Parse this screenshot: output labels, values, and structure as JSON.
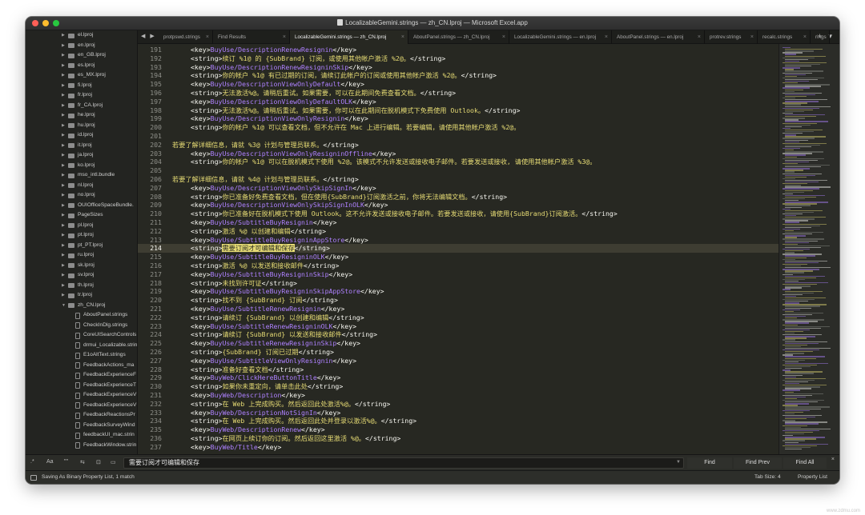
{
  "window": {
    "title": "LocalizableGemini.strings — zh_CN.lproj — Microsoft Excel.app"
  },
  "sidebar": {
    "items": [
      {
        "label": "el.lproj",
        "kind": "folder",
        "level": 1
      },
      {
        "label": "en.lproj",
        "kind": "folder",
        "level": 1
      },
      {
        "label": "en_GB.lproj",
        "kind": "folder",
        "level": 1
      },
      {
        "label": "es.lproj",
        "kind": "folder",
        "level": 1
      },
      {
        "label": "es_MX.lproj",
        "kind": "folder",
        "level": 1
      },
      {
        "label": "fi.lproj",
        "kind": "folder",
        "level": 1
      },
      {
        "label": "fr.lproj",
        "kind": "folder",
        "level": 1
      },
      {
        "label": "fr_CA.lproj",
        "kind": "folder",
        "level": 1
      },
      {
        "label": "he.lproj",
        "kind": "folder",
        "level": 1
      },
      {
        "label": "hu.lproj",
        "kind": "folder",
        "level": 1
      },
      {
        "label": "id.lproj",
        "kind": "folder",
        "level": 1
      },
      {
        "label": "it.lproj",
        "kind": "folder",
        "level": 1
      },
      {
        "label": "ja.lproj",
        "kind": "folder",
        "level": 1
      },
      {
        "label": "ko.lproj",
        "kind": "folder",
        "level": 1
      },
      {
        "label": "mso_intl.bundle",
        "kind": "folder",
        "level": 1
      },
      {
        "label": "nl.lproj",
        "kind": "folder",
        "level": 1
      },
      {
        "label": "no.lproj",
        "kind": "folder",
        "level": 1
      },
      {
        "label": "OUIOfficeSpaceBundle.",
        "kind": "folder",
        "level": 1
      },
      {
        "label": "PageSizes",
        "kind": "folder",
        "level": 1
      },
      {
        "label": "pl.lproj",
        "kind": "folder",
        "level": 1
      },
      {
        "label": "pt.lproj",
        "kind": "folder",
        "level": 1
      },
      {
        "label": "pt_PT.lproj",
        "kind": "folder",
        "level": 1
      },
      {
        "label": "ru.lproj",
        "kind": "folder",
        "level": 1
      },
      {
        "label": "sk.lproj",
        "kind": "folder",
        "level": 1
      },
      {
        "label": "sv.lproj",
        "kind": "folder",
        "level": 1
      },
      {
        "label": "th.lproj",
        "kind": "folder",
        "level": 1
      },
      {
        "label": "tr.lproj",
        "kind": "folder",
        "level": 1
      },
      {
        "label": "zh_CN.lproj",
        "kind": "folder-open",
        "level": 1
      },
      {
        "label": "AboutPanel.strings",
        "kind": "file",
        "level": 2
      },
      {
        "label": "CheckInDlg.strings",
        "kind": "file",
        "level": 2
      },
      {
        "label": "CoreUISearchControls",
        "kind": "file",
        "level": 2
      },
      {
        "label": "drmui_Localizable.strin",
        "kind": "file",
        "level": 2
      },
      {
        "label": "E1oAltText.strings",
        "kind": "file",
        "level": 2
      },
      {
        "label": "FeedbackActions_ma",
        "kind": "file",
        "level": 2
      },
      {
        "label": "FeedbackExperienceF",
        "kind": "file",
        "level": 2
      },
      {
        "label": "FeedbackExperienceT",
        "kind": "file",
        "level": 2
      },
      {
        "label": "FeedbackExperienceV",
        "kind": "file",
        "level": 2
      },
      {
        "label": "FeedbackExperienceV",
        "kind": "file",
        "level": 2
      },
      {
        "label": "FeedbackReactionsPr",
        "kind": "file",
        "level": 2
      },
      {
        "label": "FeedbackSurveyWind",
        "kind": "file",
        "level": 2
      },
      {
        "label": "feedbackUI_mac.strin",
        "kind": "file",
        "level": 2
      },
      {
        "label": "FeedbackWindow.strin",
        "kind": "file",
        "level": 2
      }
    ]
  },
  "tabs": [
    {
      "label": "protpswd.strings",
      "active": false
    },
    {
      "label": "Find Results",
      "active": false
    },
    {
      "label": "LocalizableGemini.strings — zh_CN.lproj",
      "active": true
    },
    {
      "label": "AboutPanel.strings — zh_CN.lproj",
      "active": false
    },
    {
      "label": "LocalizableGemini.strings — en.lproj",
      "active": false
    },
    {
      "label": "AboutPanel.strings — en.lproj",
      "active": false
    },
    {
      "label": "protrev.strings",
      "active": false
    },
    {
      "label": "recalc.strings",
      "active": false
    },
    {
      "label": "rings",
      "active": false
    }
  ],
  "tab_nav": "◀ ▶",
  "tab_extra": "+ ▾",
  "editor": {
    "current_line": 214,
    "lines": [
      {
        "n": "191",
        "t": "key",
        "indent": true,
        "v": "BuyUse/DescriptionRenewResignin"
      },
      {
        "n": "192",
        "t": "string",
        "indent": true,
        "v": "续订 %1@ 的 {SubBrand} 订阅，或使用其他帐户激活 %2@。"
      },
      {
        "n": "193",
        "t": "key",
        "indent": true,
        "v": "BuyUse/DescriptionRenewResigninSkip"
      },
      {
        "n": "194",
        "t": "string",
        "indent": true,
        "v": "你的帐户 %1@ 有已过期的订阅，请续订此帐户的订阅或使用其他帐户激活 %2@。"
      },
      {
        "n": "195",
        "t": "key",
        "indent": true,
        "v": "BuyUse/DescriptionViewOnlyDefault"
      },
      {
        "n": "196",
        "t": "string",
        "indent": true,
        "v": "无法激活%@。请稍后重试。如果需要，可以在此期间免费查看文档。"
      },
      {
        "n": "197",
        "t": "key",
        "indent": true,
        "v": "BuyUse/DescriptionViewOnlyDefaultOLK"
      },
      {
        "n": "198",
        "t": "string",
        "indent": true,
        "v": "无法激活%@。请稍后重试。如果需要，你可以在此期间在脱机模式下免费使用 Outlook。"
      },
      {
        "n": "199",
        "t": "key",
        "indent": true,
        "v": "BuyUse/DescriptionViewOnlyResignin"
      },
      {
        "n": "200",
        "t": "string-open",
        "indent": true,
        "v": "你的帐户 %1@ 可以查看文档，但不允许在 Mac 上进行编辑。若要编辑，请使用其他帐户激活 %2@。"
      },
      {
        "n": "201",
        "t": "blank",
        "indent": false,
        "v": ""
      },
      {
        "n": "202",
        "t": "string-close",
        "indent": false,
        "v": "若要了解详细信息，请就 %3@ 计划与管理员联系。"
      },
      {
        "n": "203",
        "t": "key",
        "indent": true,
        "v": "BuyUse/DescriptionViewOnlyResigninOffline"
      },
      {
        "n": "204",
        "t": "string-open",
        "indent": true,
        "v": "你的帐户 %1@ 可以在脱机模式下使用 %2@。该模式不允许发送或接收电子邮件。若要发送或接收, 请使用其他帐户激活 %3@。"
      },
      {
        "n": "205",
        "t": "blank",
        "indent": false,
        "v": ""
      },
      {
        "n": "206",
        "t": "string-close",
        "indent": false,
        "v": "若要了解详细信息，请就 %4@ 计划与管理员联系。"
      },
      {
        "n": "207",
        "t": "key",
        "indent": true,
        "v": "BuyUse/DescriptionViewOnlySkipSignIn"
      },
      {
        "n": "208",
        "t": "string",
        "indent": true,
        "v": "你已准备好免费查看文档，但在使用{SubBrand}订阅激活之前，你将无法编辑文档。"
      },
      {
        "n": "209",
        "t": "key",
        "indent": true,
        "v": "BuyUse/DescriptionViewOnlySkipSignInOLK"
      },
      {
        "n": "210",
        "t": "string",
        "indent": true,
        "v": "你已准备好在脱机模式下使用 Outlook。这不允许发送或接收电子邮件。若要发送或接收，请使用{SubBrand}订阅激活。"
      },
      {
        "n": "211",
        "t": "key",
        "indent": true,
        "v": "BuyUse/SubtitleBuyResignin"
      },
      {
        "n": "212",
        "t": "string",
        "indent": true,
        "v": "激活 %@ 以创建和编辑"
      },
      {
        "n": "213",
        "t": "key",
        "indent": true,
        "v": "BuyUse/SubtitleBuyResigninAppStore"
      },
      {
        "n": "214",
        "t": "string-hl",
        "indent": true,
        "v": "需要订阅才可编辑和保存"
      },
      {
        "n": "215",
        "t": "key",
        "indent": true,
        "v": "BuyUse/SubtitleBuyResigninOLK"
      },
      {
        "n": "216",
        "t": "string",
        "indent": true,
        "v": "激活 %@ 以发送和接收邮件"
      },
      {
        "n": "217",
        "t": "key",
        "indent": true,
        "v": "BuyUse/SubtitleBuyResigninSkip"
      },
      {
        "n": "218",
        "t": "string",
        "indent": true,
        "v": "未找到许可证"
      },
      {
        "n": "219",
        "t": "key",
        "indent": true,
        "v": "BuyUse/SubtitleBuyResigninSkipAppStore"
      },
      {
        "n": "220",
        "t": "string",
        "indent": true,
        "v": "找不到 {SubBrand} 订阅"
      },
      {
        "n": "221",
        "t": "key",
        "indent": true,
        "v": "BuyUse/SubtitleRenewResignin"
      },
      {
        "n": "222",
        "t": "string",
        "indent": true,
        "v": "请续订 {SubBrand} 以创建和编辑"
      },
      {
        "n": "223",
        "t": "key",
        "indent": true,
        "v": "BuyUse/SubtitleRenewResigninOLK"
      },
      {
        "n": "224",
        "t": "string",
        "indent": true,
        "v": "请续订 {SubBrand} 以发送和接收邮件"
      },
      {
        "n": "225",
        "t": "key",
        "indent": true,
        "v": "BuyUse/SubtitleRenewResigninSkip"
      },
      {
        "n": "226",
        "t": "string",
        "indent": true,
        "v": "{SubBrand} 订阅已过期"
      },
      {
        "n": "227",
        "t": "key",
        "indent": true,
        "v": "BuyUse/SubtitleViewOnlyResignin"
      },
      {
        "n": "228",
        "t": "string",
        "indent": true,
        "v": "准备好查看文档"
      },
      {
        "n": "229",
        "t": "key",
        "indent": true,
        "v": "BuyWeb/ClickHereButtonTitle"
      },
      {
        "n": "230",
        "t": "string",
        "indent": true,
        "v": "如果你未重定向，请单击此处"
      },
      {
        "n": "231",
        "t": "key",
        "indent": true,
        "v": "BuyWeb/Description"
      },
      {
        "n": "232",
        "t": "string",
        "indent": true,
        "v": "在 Web 上完成购买。然后返回此处激活%@。"
      },
      {
        "n": "233",
        "t": "key",
        "indent": true,
        "v": "BuyWeb/DescriptionNotSignIn"
      },
      {
        "n": "234",
        "t": "string",
        "indent": true,
        "v": "在 Web 上完成购买。然后返回此处并登录以激活%@。"
      },
      {
        "n": "235",
        "t": "key",
        "indent": true,
        "v": "BuyWeb/DescriptionRenew"
      },
      {
        "n": "236",
        "t": "string",
        "indent": true,
        "v": "在网页上续订你的订阅。然后返回这里激活 %@。"
      },
      {
        "n": "237",
        "t": "key",
        "indent": true,
        "v": "BuyWeb/Title"
      }
    ]
  },
  "findbar": {
    "option_regex": ".*",
    "option_case": "Aa",
    "option_word": "\"\"",
    "option_wrap": "⇆",
    "option_selection": "⊡",
    "option_highlight": "▭",
    "query": "需要订阅才可编辑和保存",
    "find_label": "Find",
    "find_prev_label": "Find Prev",
    "find_all_label": "Find All",
    "close": "×"
  },
  "statusbar": {
    "message": "Saving As Binary Property List, 1 match",
    "tab_size": "Tab Size: 4",
    "syntax": "Property List"
  },
  "watermark": "www.zdmu.com",
  "colors": {
    "editor_bg": "#272822",
    "key_value": "#ae81ff",
    "string_value": "#e6db74",
    "highlight": "#e6db74"
  }
}
